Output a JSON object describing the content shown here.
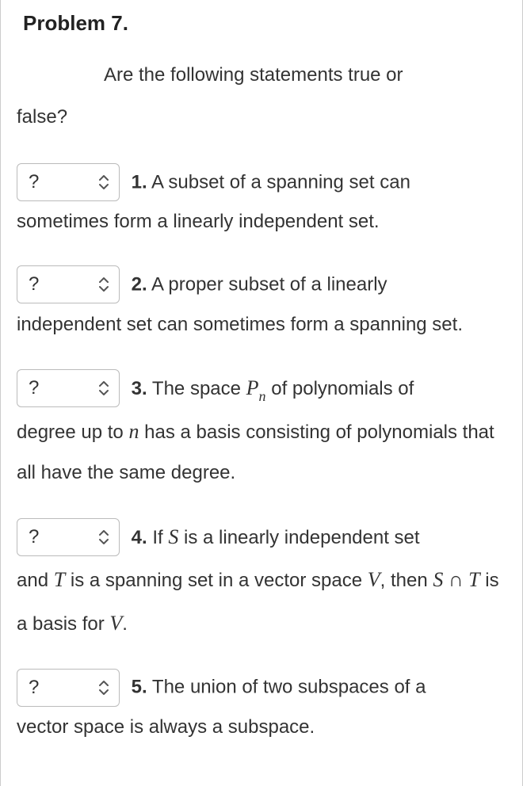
{
  "header": "Problem 7.",
  "prompt_part1": "Are the following statements true or",
  "prompt_part2": "false?",
  "select_placeholder": "?",
  "statements": {
    "s1": {
      "num": "1.",
      "lead": " A subset of a spanning set can",
      "rest": "sometimes form a linearly independent set."
    },
    "s2": {
      "num": "2.",
      "lead": " A proper subset of a linearly",
      "rest": "independent set can sometimes form a spanning set."
    },
    "s3": {
      "num": "3.",
      "lead_a": " The space ",
      "var1": "P",
      "sub1": "n",
      "lead_b": " of polynomials of",
      "rest_a": "degree up to ",
      "var2": "n",
      "rest_b": " has a basis consisting of polynomials that all have the same degree."
    },
    "s4": {
      "num": "4.",
      "lead_a": " If ",
      "var1": "S",
      "lead_b": " is a linearly independent set",
      "rest_a": "and ",
      "var2": "T",
      "rest_b": " is a spanning set in a vector space ",
      "var3": "V",
      "rest_c": ", then ",
      "var4": "S",
      "cap": " ∩ ",
      "var5": "T",
      "rest_d": " is a basis for ",
      "var6": "V",
      "rest_e": "."
    },
    "s5": {
      "num": "5.",
      "lead": " The union of two subspaces of a",
      "rest": "vector space is always a subspace."
    }
  }
}
